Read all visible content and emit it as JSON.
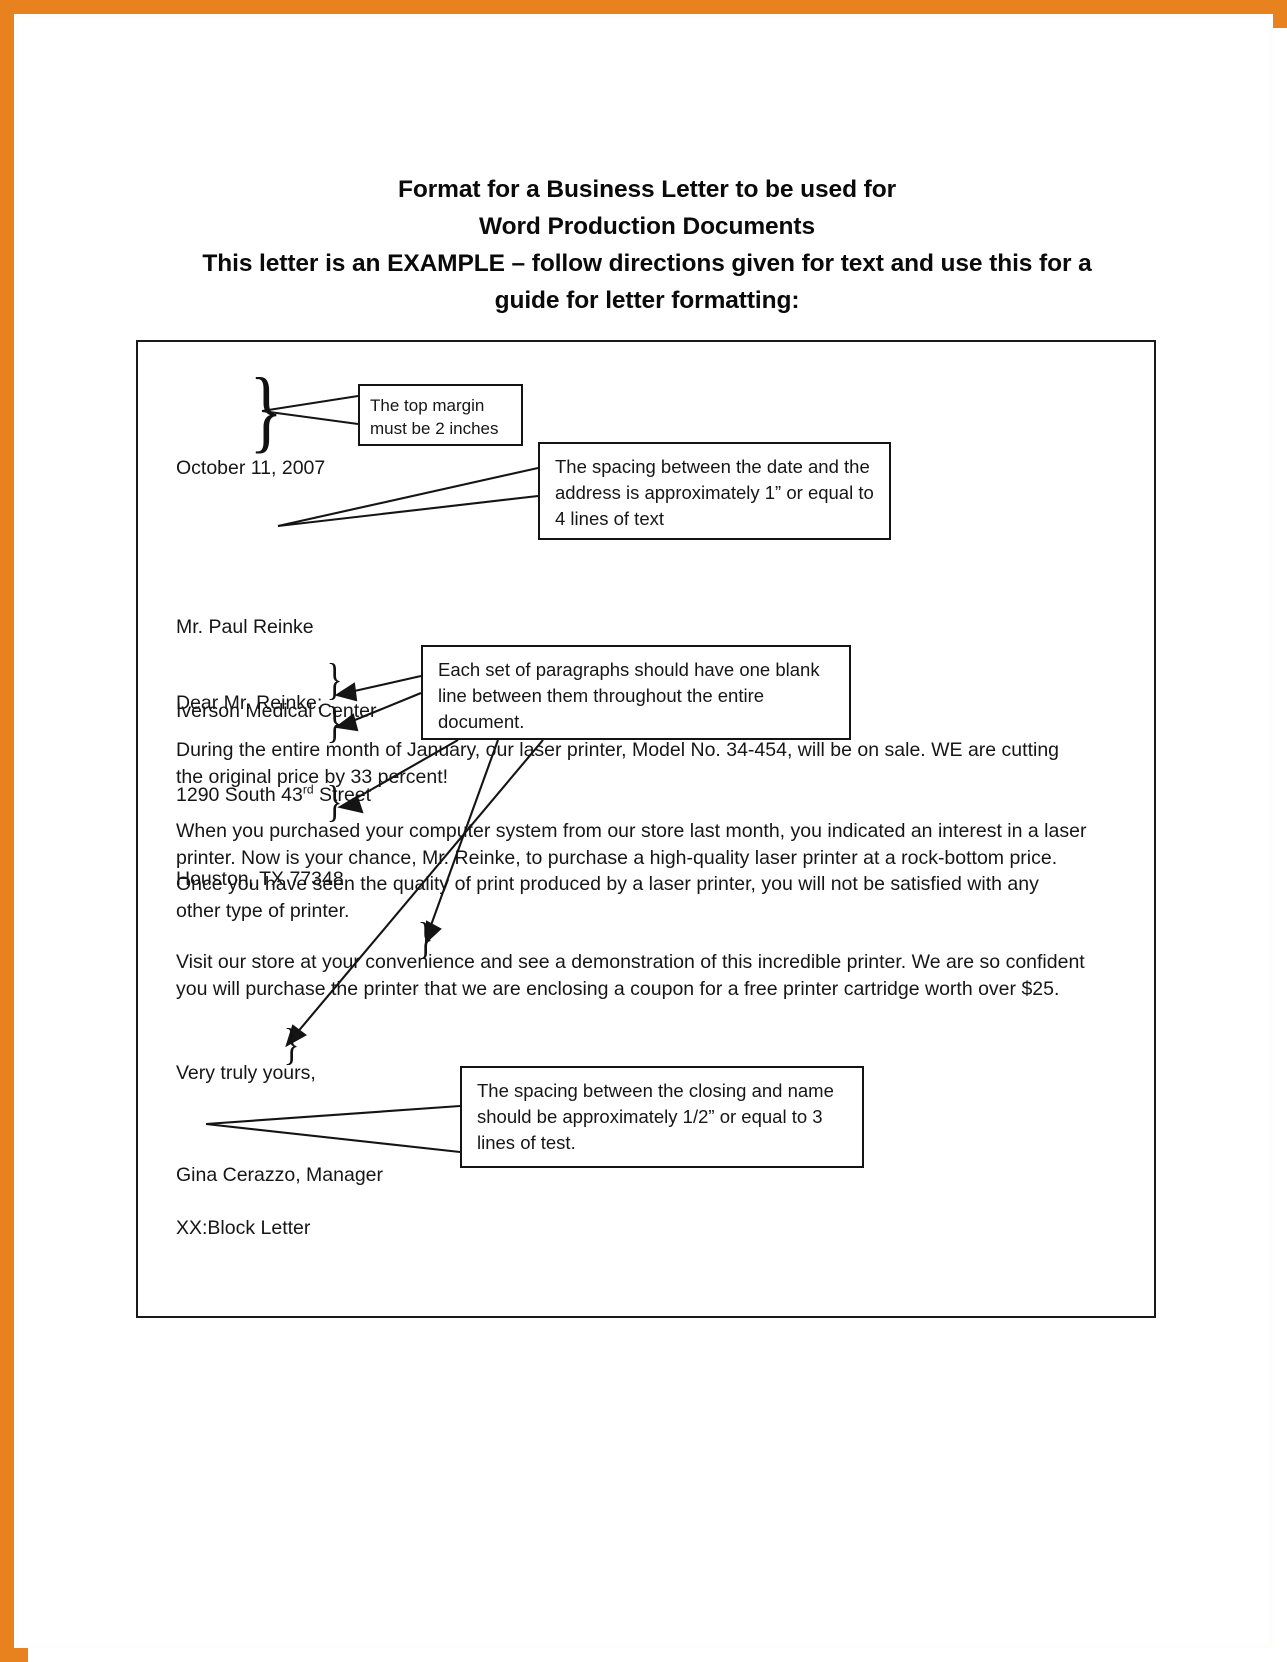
{
  "document": {
    "heading_lines": [
      "Format for a Business Letter to be used for",
      "Word Production Documents",
      "This letter is an EXAMPLE – follow directions given for text and use this for a",
      "guide for letter formatting:"
    ],
    "letter": {
      "date": "October 11, 2007",
      "address_lines": [
        "Mr. Paul Reinke",
        "Iverson Medical Center",
        "1290 South 43rd Street",
        "Houston, TX 77348"
      ],
      "address_street_number": "1290 South 43",
      "address_street_ordinal": "rd",
      "address_street_suffix": " Street",
      "salutation": "Dear Mr. Reinke:",
      "paragraph_1": "During the entire month of January, our laser printer, Model No. 34-454, will be on sale. WE are cutting the original price by 33 percent!",
      "paragraph_2": "When you purchased your computer system from our store last month, you indicated an interest in a laser printer. Now is your chance, Mr. Reinke, to purchase a high-quality laser printer at a rock-bottom price. Once you have seen the quality of print produced by a laser printer, you will not be satisfied with any other type of printer.",
      "paragraph_3": "Visit our store at your convenience and see a demonstration of this incredible printer. We are so confident you will purchase the printer that we are enclosing a coupon for a free printer cartridge worth over $25.",
      "closing": "Very truly yours,",
      "signer": "Gina Cerazzo, Manager",
      "reference_line": "XX:Block Letter"
    },
    "callouts": {
      "top_margin": "The top margin must be 2 inches",
      "date_spacing": "The spacing between the date and the address is approximately 1” or equal to 4 lines of text",
      "paragraph_spacing": "Each set of paragraphs should have one blank line between them throughout the entire document.",
      "closing_spacing": "The spacing between the closing and name should be approximately 1/2” or equal to 3 lines of test."
    },
    "colors": {
      "scan_border": "#e8821e",
      "page_background": "#ffffff",
      "text": "#161616",
      "rule": "#1a1a1a"
    }
  }
}
